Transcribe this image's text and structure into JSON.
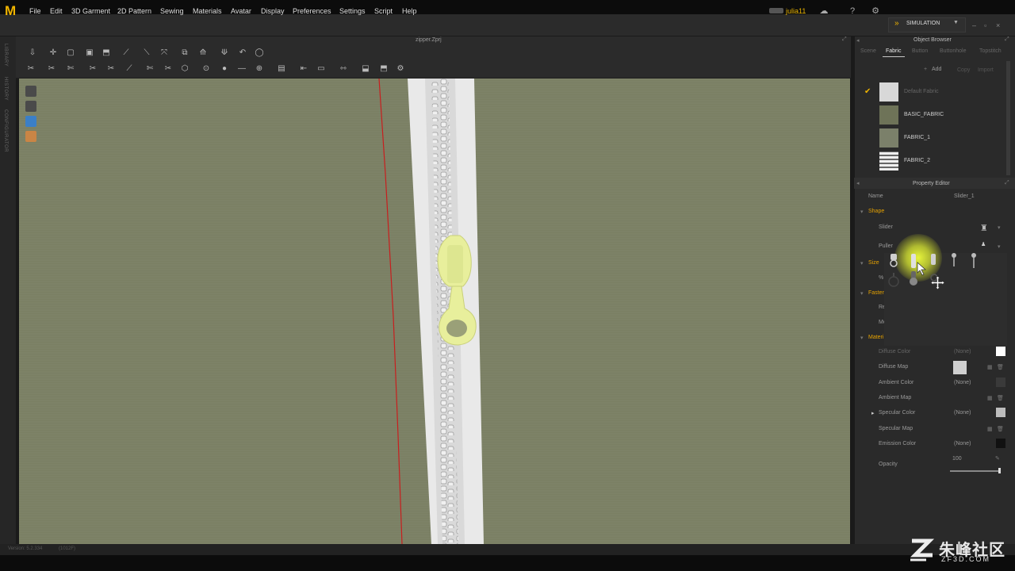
{
  "menu": {
    "items": [
      "File",
      "Edit",
      "3D Garment",
      "2D Pattern",
      "Sewing",
      "Materials",
      "Avatar",
      "Display",
      "Preferences",
      "Settings",
      "Script",
      "Help"
    ]
  },
  "user": {
    "name": "julia11"
  },
  "mode": {
    "label": "SIMULATION"
  },
  "viewport": {
    "file_name": "zipper.Zprj"
  },
  "left_strip": {
    "labels": [
      "LIBRARY",
      "HISTORY",
      "CONFIGURATOR"
    ]
  },
  "object_browser": {
    "title": "Object Browser",
    "tabs": [
      "Scene",
      "Fabric",
      "Button",
      "Buttonhole",
      "Topstitch"
    ],
    "active_tab": "Fabric",
    "add_label": "Add",
    "copy_label": "Copy",
    "import_label": "Import",
    "fabrics": [
      {
        "name": "Default Fabric",
        "selected": true,
        "swatch": "#d8d8d8"
      },
      {
        "name": "BASIC_FABRIC",
        "selected": false,
        "swatch": "#6e7358"
      },
      {
        "name": "FABRIC_1",
        "selected": false,
        "swatch": "#7b806a"
      },
      {
        "name": "FABRIC_2",
        "selected": false,
        "swatch": "zipper"
      }
    ]
  },
  "property_editor": {
    "title": "Property Editor",
    "name_label": "Name",
    "name_value": "Slider_1",
    "sections": {
      "shape": "Shape",
      "size": "Size",
      "fastener": "Faster",
      "material": "Materi"
    },
    "shape": {
      "slider_label": "Slider",
      "puller_label": "Puller"
    },
    "size": {
      "percent_label": "%"
    },
    "fastener": {
      "row1": "Re",
      "row2": "Me"
    },
    "material": {
      "rows": [
        {
          "label": "Diffuse Color",
          "value": "(None)",
          "swatch": "#ffffff"
        },
        {
          "label": "Diffuse Map",
          "value": "",
          "swatch": "#cfcfcf"
        },
        {
          "label": "Ambient Color",
          "value": "(None)",
          "swatch": "#3a3a3a"
        },
        {
          "label": "Ambient Map",
          "value": "",
          "swatch": ""
        },
        {
          "label": "Specular Color",
          "value": "(None)",
          "swatch": "#bdbdbd"
        },
        {
          "label": "Specular Map",
          "value": "",
          "swatch": ""
        },
        {
          "label": "Emission Color",
          "value": "(None)",
          "swatch": "#111111"
        }
      ],
      "opacity_label": "Opacity",
      "opacity_value": "100"
    }
  },
  "status": {
    "left": "Version: 5.2.334",
    "right": "(1012F)"
  },
  "watermark": {
    "cn": "朱峰社区",
    "url": "ZF3D.COM"
  },
  "colors": {
    "accent": "#f0b400",
    "viewport_bg": "#7d8267",
    "zipper_slider": "#e8ef9c"
  }
}
